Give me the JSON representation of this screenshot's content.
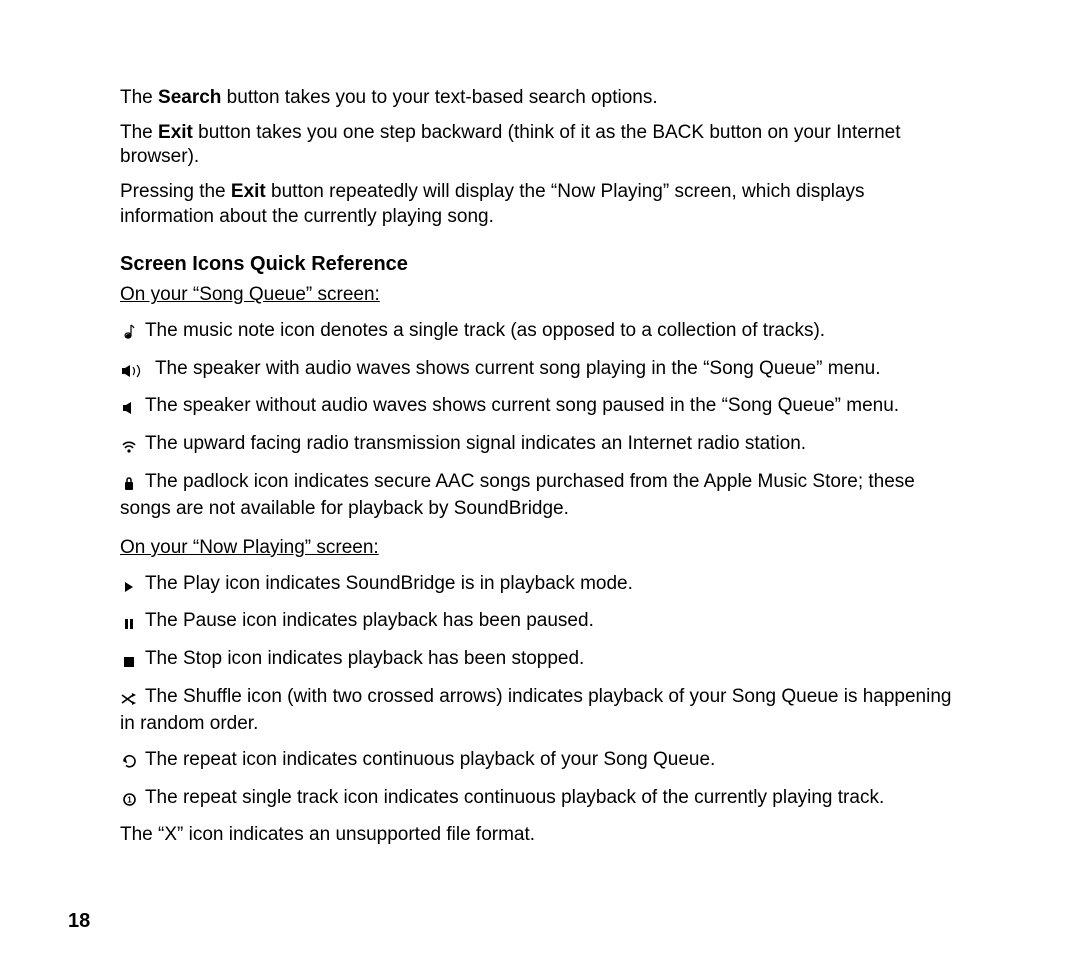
{
  "paras": {
    "search_pre": "The ",
    "search_bold": "Search",
    "search_post": " button takes you to your text-based search options.",
    "exit1_pre": "The ",
    "exit1_bold": "Exit",
    "exit1_post": " button takes you one step backward (think of it as the BACK button on your Internet browser).",
    "exit2_pre": "Pressing the ",
    "exit2_bold": "Exit",
    "exit2_post": " button repeatedly will display the “Now Playing” screen, which displays information about the currently playing song."
  },
  "heading": "Screen Icons Quick Reference",
  "song_queue_label": "On your “Song Queue” screen:",
  "now_playing_label": "On your “Now Playing” screen:",
  "icons": {
    "music_note": "The music note icon denotes a single track (as opposed to a collection of tracks).",
    "speaker_waves": "The speaker with audio waves shows current song playing in the “Song Queue” menu.",
    "speaker_no_waves": "The speaker without audio waves shows current song paused in the “Song Queue” menu.",
    "radio": "The upward facing radio transmission signal indicates an Internet radio station.",
    "padlock": "The padlock icon indicates secure AAC songs purchased from the Apple Music Store; these songs are not available for playback by SoundBridge.",
    "play": "The Play icon indicates SoundBridge is in playback mode.",
    "pause": "The Pause icon indicates playback has been paused.",
    "stop": "The Stop icon indicates playback has been stopped.",
    "shuffle": "The Shuffle icon (with two crossed arrows) indicates playback of your Song Queue is happening in random order.",
    "repeat": "The repeat icon indicates continuous playback of your Song Queue.",
    "repeat_single": "The repeat single track icon indicates continuous playback of the currently playing track.",
    "unsupported": "The “X” icon indicates an unsupported file format."
  },
  "page_number": "18"
}
